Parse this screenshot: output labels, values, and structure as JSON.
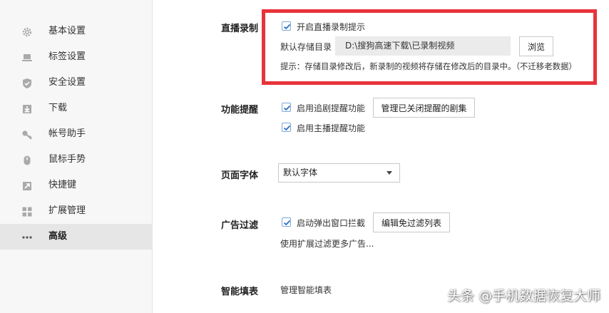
{
  "sidebar": {
    "items": [
      {
        "label": "基本设置",
        "icon": "gear-icon"
      },
      {
        "label": "标签设置",
        "icon": "laptop-icon"
      },
      {
        "label": "安全设置",
        "icon": "shield-check-icon"
      },
      {
        "label": "下载",
        "icon": "download-icon"
      },
      {
        "label": "帐号助手",
        "icon": "key-icon"
      },
      {
        "label": "鼠标手势",
        "icon": "mouse-icon"
      },
      {
        "label": "快捷键",
        "icon": "arrow-up-right-icon"
      },
      {
        "label": "扩展管理",
        "icon": "grid-icon"
      },
      {
        "label": "高级",
        "icon": "more-dots-icon",
        "active": true
      }
    ]
  },
  "live": {
    "title": "直播录制",
    "checkbox_label": "开启直播录制提示",
    "checked": true,
    "path_label": "默认存储目录",
    "path_value": "D:\\搜狗高速下载\\已录制视频",
    "browse_button": "浏览",
    "hint": "提示：存储目录修改后，新录制的视频将存储在修改后的目录中。（不迁移老数据）"
  },
  "reminder": {
    "title": "功能提醒",
    "option1": "启用追剧提醒功能",
    "option1_checked": true,
    "manage_button": "管理已关闭提醒的剧集",
    "option2": "启用主播提醒功能",
    "option2_checked": true
  },
  "font": {
    "title": "页面字体",
    "selected": "默认字体"
  },
  "adfilter": {
    "title": "广告过滤",
    "option": "启动弹出窗口拦截",
    "option_checked": true,
    "edit_button": "编辑免过滤列表",
    "more_link": "使用扩展过滤更多广告..."
  },
  "autofill": {
    "title": "智能填表",
    "manage_link": "管理智能填表"
  },
  "watermark": "头条 @手机数据恢复大师",
  "colors": {
    "highlight": "#e8333b",
    "checkbox": "#2f6fbd"
  }
}
